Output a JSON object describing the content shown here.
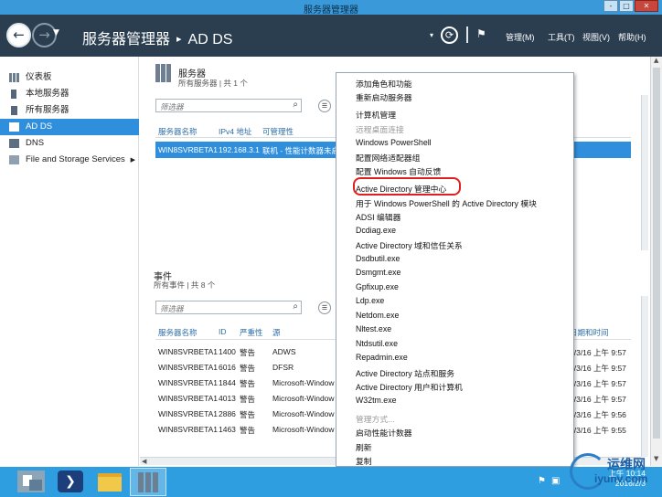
{
  "window": {
    "title": "服务器管理器",
    "buttons": [
      "-",
      "□",
      "✕"
    ]
  },
  "header": {
    "breadcrumb_root": "服务器管理器",
    "breadcrumb_sep": "▸",
    "breadcrumb_current": "AD DS",
    "menus": [
      "管理(M)",
      "工具(T)",
      "视图(V)",
      "帮助(H)"
    ]
  },
  "sidebar": {
    "items": [
      {
        "label": "仪表板",
        "icon": "dashboard-icon"
      },
      {
        "label": "本地服务器",
        "icon": "server-icon"
      },
      {
        "label": "所有服务器",
        "icon": "servers-icon"
      },
      {
        "label": "AD DS",
        "icon": "adds-icon",
        "active": true
      },
      {
        "label": "DNS",
        "icon": "dns-icon"
      },
      {
        "label": "File and Storage Services",
        "icon": "storage-icon",
        "caret": "▶"
      }
    ]
  },
  "servers": {
    "title": "服务器",
    "subtitle": "所有服务器 | 共 1 个",
    "filter_placeholder": "筛选器",
    "columns": [
      "服务器名称",
      "IPv4 地址",
      "可管理性"
    ],
    "rows": [
      {
        "name": "WIN8SVRBETA1",
        "ip": "192.168.3.1",
        "status": "联机 - 性能计数器未启"
      }
    ]
  },
  "events": {
    "title": "事件",
    "subtitle": "所有事件 | 共 8 个",
    "filter_placeholder": "筛选器",
    "columns": [
      "服务器名称",
      "ID",
      "严重性",
      "源",
      "日期和时间"
    ],
    "rows": [
      {
        "server": "WIN8SVRBETA1",
        "id": "1400",
        "severity": "警告",
        "source": "ADWS",
        "time": "2/3/16 上午 9:57"
      },
      {
        "server": "WIN8SVRBETA1",
        "id": "6016",
        "severity": "警告",
        "source": "DFSR",
        "time": "2/3/16 上午 9:57"
      },
      {
        "server": "WIN8SVRBETA1",
        "id": "1844",
        "severity": "警告",
        "source": "Microsoft-Window",
        "time": "2/3/16 上午 9:57"
      },
      {
        "server": "WIN8SVRBETA1",
        "id": "4013",
        "severity": "警告",
        "source": "Microsoft-Window",
        "time": "2/3/16 上午 9:57"
      },
      {
        "server": "WIN8SVRBETA1",
        "id": "2886",
        "severity": "警告",
        "source": "Microsoft-Window",
        "time": "2/3/16 上午 9:56"
      },
      {
        "server": "WIN8SVRBETA1",
        "id": "1463",
        "severity": "警告",
        "source": "Microsoft-Window",
        "time": "2/3/16 上午 9:55"
      }
    ]
  },
  "context_menu": {
    "items": [
      {
        "label": "添加角色和功能"
      },
      {
        "label": "重新启动服务器"
      },
      {
        "label": "计算机管理"
      },
      {
        "label": "远程桌面连接",
        "disabled": true
      },
      {
        "label": "Windows PowerShell"
      },
      {
        "label": "配置网络适配器组"
      },
      {
        "label": "配置 Windows 自动反馈"
      },
      {
        "label": "Active Directory 管理中心",
        "highlighted": true
      },
      {
        "label": "用于 Windows PowerShell 的 Active Directory 模块"
      },
      {
        "label": "ADSI 编辑器"
      },
      {
        "label": "Dcdiag.exe"
      },
      {
        "label": "Active Directory 域和信任关系"
      },
      {
        "label": "Dsdbutil.exe"
      },
      {
        "label": "Dsmgmt.exe"
      },
      {
        "label": "Gpfixup.exe"
      },
      {
        "label": "Ldp.exe"
      },
      {
        "label": "Netdom.exe"
      },
      {
        "label": "Nltest.exe"
      },
      {
        "label": "Ntdsutil.exe"
      },
      {
        "label": "Repadmin.exe"
      },
      {
        "label": "Active Directory 站点和服务"
      },
      {
        "label": "Active Directory 用户和计算机"
      },
      {
        "label": "W32tm.exe"
      },
      {
        "label": "管理方式...",
        "disabled": true
      },
      {
        "label": "启动性能计数器"
      },
      {
        "label": "刷新"
      },
      {
        "label": "复制"
      }
    ]
  },
  "taskbar": {
    "clock_time": "上午 10:14",
    "clock_date": "2016/2/3"
  },
  "watermark": {
    "line1": "运维网",
    "line2": "iyunv.com"
  },
  "colors": {
    "header": "#2a3e50",
    "accent": "#2f8fdc",
    "taskbar": "#2e9ee0",
    "highlight_ring": "#e02020"
  }
}
